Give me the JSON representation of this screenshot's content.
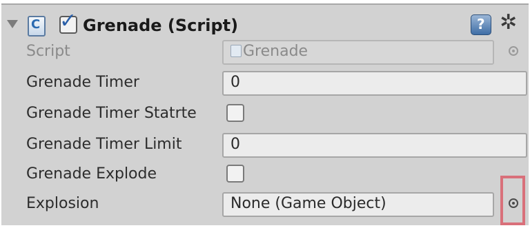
{
  "component": {
    "title": "Grenade (Script)",
    "enabled": true,
    "icons": {
      "foldout": "foldout-arrow-icon",
      "script": "script-icon",
      "help": "help-icon",
      "settings": "gear-icon"
    }
  },
  "fields": {
    "script": {
      "label": "Script",
      "value": "Grenade"
    },
    "timer": {
      "label": "Grenade Timer",
      "value": "0"
    },
    "timer_started": {
      "label": "Grenade Timer Statrte",
      "checked": false
    },
    "timer_limit": {
      "label": "Grenade Timer Limit",
      "value": "0"
    },
    "explode": {
      "label": "Grenade Explode",
      "checked": false
    },
    "explosion": {
      "label": "Explosion",
      "value": "None (Game Object)"
    }
  },
  "colors": {
    "panel": "#d2d2d2",
    "highlight": "#d9707a"
  }
}
